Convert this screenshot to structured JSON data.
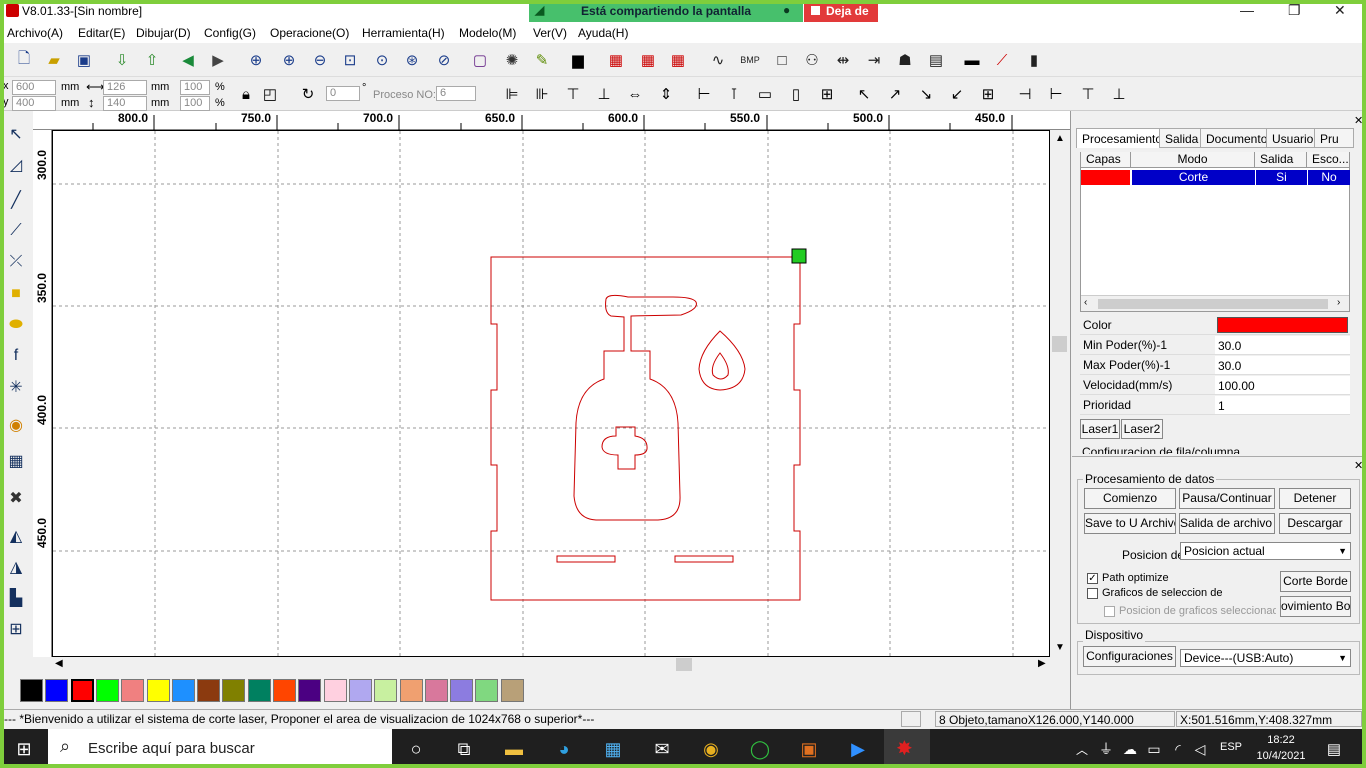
{
  "window": {
    "title": "V8.01.33-[Sin nombre]"
  },
  "share_bar": {
    "text": "Está compartiendo la pantalla",
    "stop_label": "Deja de"
  },
  "menu": [
    "Archivo(A)",
    "Editar(E)",
    "Dibujar(D)",
    "Config(G)",
    "Operacione(O)",
    "Herramienta(H)",
    "Modelo(M)",
    "Ver(V)",
    "Ayuda(H)"
  ],
  "toolbar2": {
    "x_value": "600",
    "y_value": "400",
    "unit": "mm",
    "width_value": "126",
    "height_value": "140",
    "scale_x": "100",
    "scale_y": "100",
    "percent": "%",
    "rotate_value": "0",
    "degree": "°",
    "proceso_label": "Proceso NO:",
    "proceso_value": "6"
  },
  "ruler": {
    "h_labels": [
      "800.0",
      "750.0",
      "700.0",
      "650.0",
      "600.0",
      "550.0",
      "500.0",
      "450.0"
    ],
    "v_labels": [
      "300.0",
      "350.0",
      "400.0",
      "450.0"
    ]
  },
  "palette": [
    "#000000",
    "#0000ff",
    "#ff0000",
    "#00ff00",
    "#f08080",
    "#ffff00",
    "#1e90ff",
    "#8b3a0f",
    "#808000",
    "#008060",
    "#ff4500",
    "#4b0082",
    "#ffd0e0",
    "#b0a8f0",
    "#c8f0a0",
    "#f0a070",
    "#d8789c",
    "#8c7ce0",
    "#80d880",
    "#b8a078"
  ],
  "right_panel": {
    "tabs": [
      "Procesamiento",
      "Salida",
      "Documento",
      "Usuario",
      "Pru"
    ],
    "layer_headers": [
      "Capas",
      "Modo",
      "Salida",
      "Esco..."
    ],
    "layer_row": {
      "color": "#ff0000",
      "mode": "Corte",
      "output": "Si",
      "hide": "No"
    },
    "props": [
      {
        "key": "Color",
        "value": ""
      },
      {
        "key": "Min Poder(%)-1",
        "value": "30.0"
      },
      {
        "key": "Max Poder(%)-1",
        "value": "30.0"
      },
      {
        "key": "Velocidad(mm/s)",
        "value": "100.00"
      },
      {
        "key": "Prioridad",
        "value": "1"
      }
    ],
    "laser_tabs": [
      "Laser1",
      "Laser2"
    ],
    "config_partial": "Configuracion de fila/columna",
    "data_group": "Procesamiento de datos",
    "buttons_row1": [
      "Comienzo",
      "Pausa/Continuar",
      "Detener"
    ],
    "buttons_row2": [
      "Save to U Archivo",
      "Salida de archivo U",
      "Descargar"
    ],
    "posicion_label": "Posicion de",
    "posicion_value": "Posicion actual",
    "path_optimize": "Path optimize",
    "graficos": "Graficos de seleccion de",
    "posicion_graficos": "Posicion de graficos seleccionado",
    "corte_borde": "Corte Borde",
    "movimiento_borde": "ovimiento Bord",
    "device_group": "Dispositivo",
    "config_button": "Configuraciones",
    "device_value": "Device---(USB:Auto)"
  },
  "status": {
    "message": "--- *Bienvenido a utilizar el sistema de corte laser, Proponer el area de visualizacion de 1024x768 o superior*---",
    "objects": "8 Objeto,tamanoX126.000,Y140.000",
    "coords": "X:501.516mm,Y:408.327mm"
  },
  "taskbar": {
    "search_placeholder": "Escribe aquí para buscar",
    "lang": "ESP",
    "time": "18:22",
    "date": "10/4/2021"
  }
}
